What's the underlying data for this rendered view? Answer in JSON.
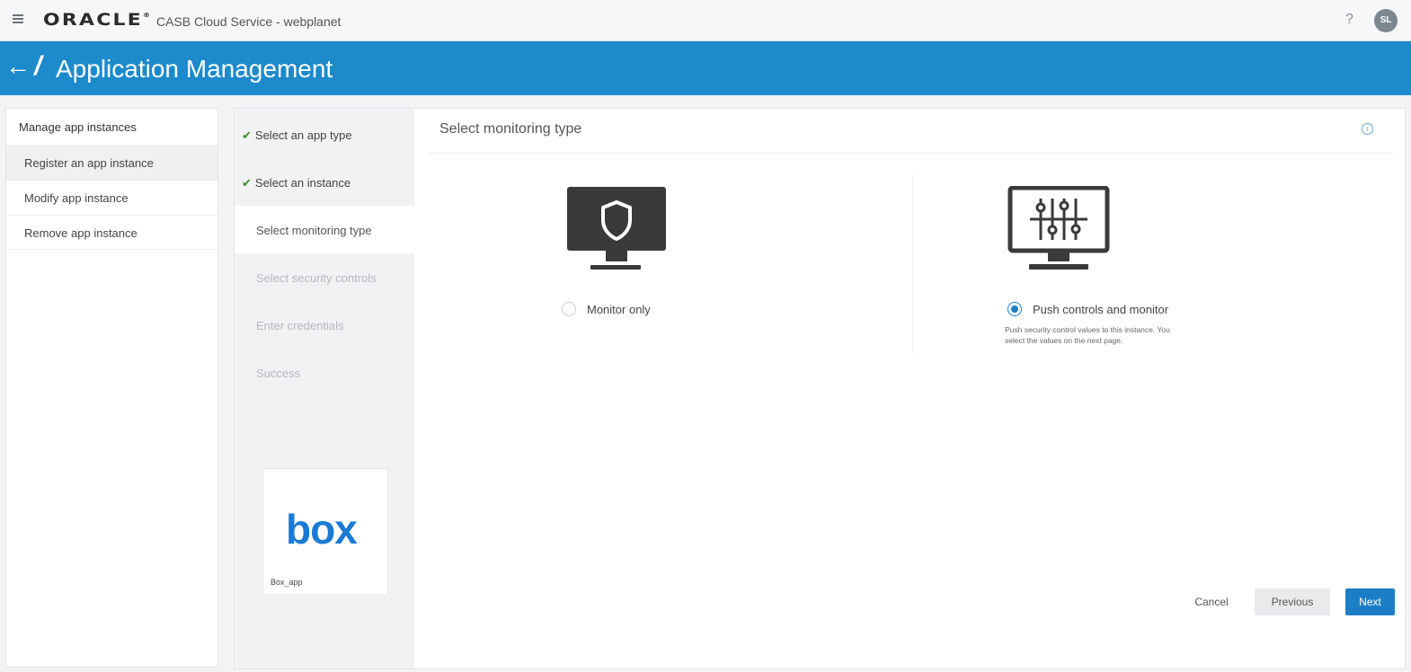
{
  "topbar": {
    "brand": "ORACLE",
    "brand_mark": "®",
    "app_title": "CASB Cloud Service - webplanet",
    "help_label": "?",
    "avatar_initials": "SL"
  },
  "header": {
    "title": "Application Management"
  },
  "left_menu": {
    "heading": "Manage app instances",
    "items": [
      {
        "label": "Register an app instance",
        "active": true
      },
      {
        "label": "Modify app instance",
        "active": false
      },
      {
        "label": "Remove app instance",
        "active": false
      }
    ]
  },
  "steps": [
    {
      "label": "Select an app type",
      "state": "done"
    },
    {
      "label": "Select an instance",
      "state": "done"
    },
    {
      "label": "Select monitoring type",
      "state": "current"
    },
    {
      "label": "Select security controls",
      "state": "future"
    },
    {
      "label": "Enter credentials",
      "state": "future"
    },
    {
      "label": "Success",
      "state": "future"
    }
  ],
  "app_card": {
    "logo_text": "box",
    "name": "Box_app"
  },
  "content": {
    "title": "Select monitoring type",
    "info_glyph": "i",
    "options": [
      {
        "label": "Monitor only",
        "selected": false,
        "icon": "shield-monitor-icon"
      },
      {
        "label": "Push controls and monitor",
        "selected": true,
        "icon": "sliders-monitor-icon",
        "description_line1": "Push security control values to this instance. You",
        "description_line2": "select the values on the next page."
      }
    ]
  },
  "buttons": {
    "cancel": "Cancel",
    "previous": "Previous",
    "next": "Next"
  },
  "colors": {
    "header_blue": "#1c8acb",
    "primary_button": "#1c7fc6",
    "check_green": "#3b8c2a"
  }
}
